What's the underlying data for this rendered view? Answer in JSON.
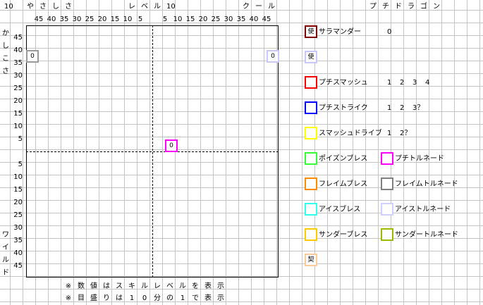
{
  "header": {
    "top_left_level": "10",
    "top_center_level": "10",
    "left_axis_label": "やさしさ",
    "center_axis_label": "レベル",
    "right_axis_label": "クール",
    "vertical_top_label": "かしこさ",
    "vertical_bottom_label": "ワイルド",
    "game_title": "プチドラゴン"
  },
  "axes": {
    "x_left_ticks": [
      "45",
      "40",
      "35",
      "30",
      "25",
      "20",
      "15",
      "10",
      "5"
    ],
    "x_right_ticks": [
      "5",
      "10",
      "15",
      "20",
      "25",
      "30",
      "35",
      "40",
      "45"
    ],
    "y_top_ticks": [
      "45",
      "40",
      "35",
      "30",
      "25",
      "20",
      "15",
      "10",
      "5"
    ],
    "y_bottom_ticks": [
      "5",
      "10",
      "15",
      "20",
      "25",
      "30",
      "35",
      "40",
      "45"
    ]
  },
  "markers": [
    {
      "id": "gray",
      "text": "0",
      "color": "#9a9a9a"
    },
    {
      "id": "lavender",
      "text": "0",
      "color": "#c8c8ff"
    },
    {
      "id": "magenta",
      "text": "0",
      "color": "#ff00ff"
    }
  ],
  "legend": {
    "salamander": {
      "icon": "使",
      "label": "サラマンダー",
      "value": "0",
      "color": "#800000"
    },
    "use_icon": {
      "icon": "使",
      "color": "#c8c8ff"
    },
    "puchi_smash": {
      "label": "プチスマッシュ",
      "levels": [
        "1",
        "2",
        "3",
        "4"
      ],
      "color": "#ff0000"
    },
    "puchi_strike": {
      "label": "プチストライク",
      "levels": [
        "1",
        "2",
        "3？"
      ],
      "color": "#0000ff"
    },
    "smash_drive": {
      "label": "スマッシュドライブ",
      "levels": [
        "1",
        "2？"
      ],
      "color": "#ffff00"
    },
    "poison_breath": {
      "label": "ポイズンブレス",
      "color": "#33ff33"
    },
    "puchi_tornado": {
      "label": "プチトルネード",
      "color": "#ff00ff"
    },
    "flame_breath": {
      "label": "フレイムブレス",
      "color": "#ff8c00"
    },
    "flame_tornado": {
      "label": "フレイムトルネード",
      "color": "#808080"
    },
    "ice_breath": {
      "label": "アイスブレス",
      "color": "#33ffee"
    },
    "ice_tornado": {
      "label": "アイストルネード",
      "color": "#d0d0ff"
    },
    "thunder_breath": {
      "label": "サンダーブレス",
      "color": "#ffcc00"
    },
    "thunder_tornado": {
      "label": "サンダートルネード",
      "color": "#99bb00"
    },
    "contract": {
      "icon": "契",
      "color": "#ffcc99"
    }
  },
  "notes": {
    "line1": "※数値はスキルレベルを表示",
    "line2": "※目盛りは10分の1で表示"
  }
}
